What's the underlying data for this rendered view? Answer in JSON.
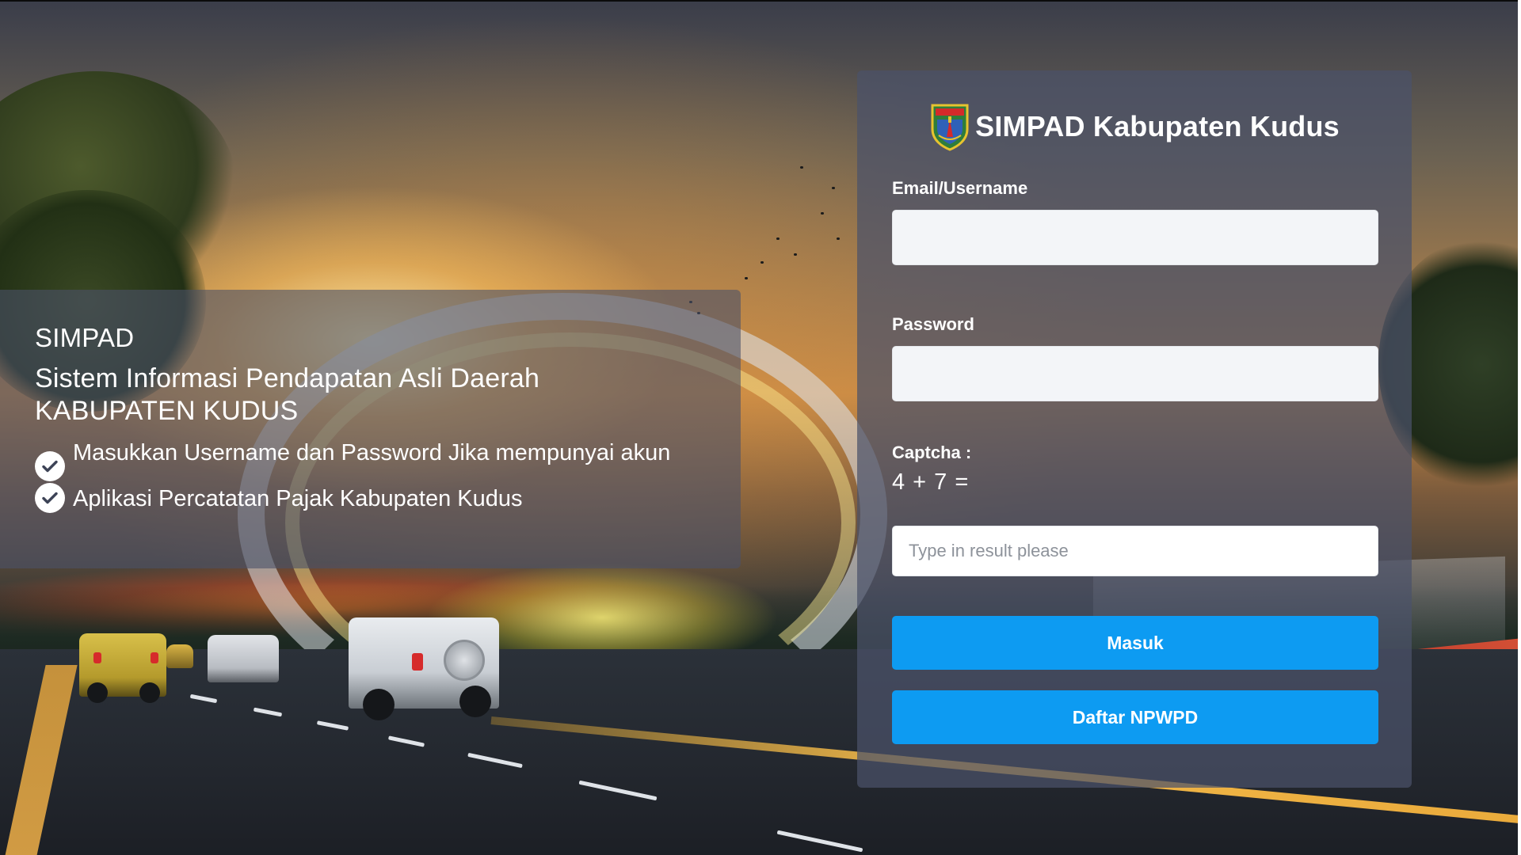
{
  "info": {
    "brand": "SIMPAD",
    "title_line1": "Sistem Informasi Pendapatan Asli Daerah",
    "title_line2": "KABUPATEN KUDUS",
    "items": [
      {
        "text": "Masukkan Username dan Password Jika mempunyai akun",
        "icon": "check-circle-icon"
      },
      {
        "text": "Aplikasi Percatatan Pajak Kabupaten Kudus",
        "icon": "check-circle-icon"
      }
    ]
  },
  "login": {
    "title": "SIMPAD Kabupaten Kudus",
    "logo_icon": "kudus-crest-logo",
    "username_label": "Email/Username",
    "username_value": "",
    "password_label": "Password",
    "password_value": "",
    "captcha_label": "Captcha :",
    "captcha_question": "4 + 7 =",
    "captcha_placeholder": "Type in result please",
    "login_button": "Masuk",
    "register_button": "Daftar NPWPD"
  },
  "colors": {
    "button": "#0d9bf2",
    "panel": "#4b5269",
    "input_bg": "#f3f5f8"
  }
}
